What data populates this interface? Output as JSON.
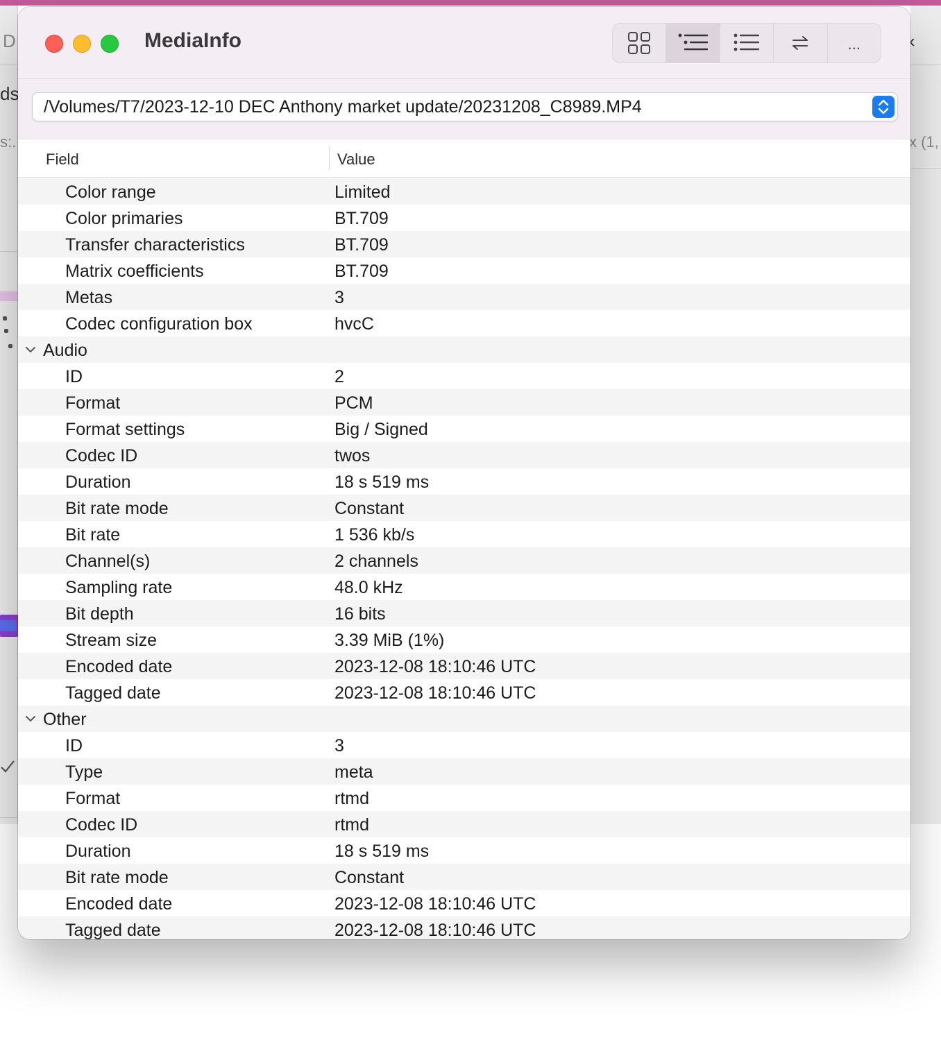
{
  "background": {
    "left_fragments": [
      "D",
      "ds",
      "s:."
    ],
    "right_fragments": [
      "‹",
      "x (1,"
    ]
  },
  "window": {
    "title": "MediaInfo",
    "view_buttons": [
      {
        "icon": "grid-view-icon",
        "active": false
      },
      {
        "icon": "tree-view-icon",
        "active": true
      },
      {
        "icon": "list-view-icon",
        "active": false
      },
      {
        "icon": "compare-arrows-icon",
        "active": false
      },
      {
        "icon": "more-icon",
        "label": "...",
        "active": false
      }
    ],
    "file_path": "/Volumes/T7/2023-12-10 DEC Anthony market update/20231208_C8989.MP4"
  },
  "table": {
    "columns": [
      "Field",
      "Value"
    ],
    "rows": [
      {
        "field": "Color range",
        "value": "Limited"
      },
      {
        "field": "Color primaries",
        "value": "BT.709"
      },
      {
        "field": "Transfer characteristics",
        "value": "BT.709"
      },
      {
        "field": "Matrix coefficients",
        "value": "BT.709"
      },
      {
        "field": "Metas",
        "value": "3"
      },
      {
        "field": "Codec configuration box",
        "value": "hvcC"
      },
      {
        "field": "Audio",
        "value": "",
        "section": true
      },
      {
        "field": "ID",
        "value": "2"
      },
      {
        "field": "Format",
        "value": "PCM"
      },
      {
        "field": "Format settings",
        "value": "Big / Signed"
      },
      {
        "field": "Codec ID",
        "value": "twos"
      },
      {
        "field": "Duration",
        "value": "18 s 519 ms"
      },
      {
        "field": "Bit rate mode",
        "value": "Constant"
      },
      {
        "field": "Bit rate",
        "value": "1 536 kb/s"
      },
      {
        "field": "Channel(s)",
        "value": "2 channels"
      },
      {
        "field": "Sampling rate",
        "value": "48.0 kHz"
      },
      {
        "field": "Bit depth",
        "value": "16 bits"
      },
      {
        "field": "Stream size",
        "value": "3.39 MiB (1%)"
      },
      {
        "field": "Encoded date",
        "value": "2023-12-08 18:10:46 UTC"
      },
      {
        "field": "Tagged date",
        "value": "2023-12-08 18:10:46 UTC"
      },
      {
        "field": "Other",
        "value": "",
        "section": true
      },
      {
        "field": "ID",
        "value": "3"
      },
      {
        "field": "Type",
        "value": "meta"
      },
      {
        "field": "Format",
        "value": "rtmd"
      },
      {
        "field": "Codec ID",
        "value": "rtmd"
      },
      {
        "field": "Duration",
        "value": "18 s 519 ms"
      },
      {
        "field": "Bit rate mode",
        "value": "Constant"
      },
      {
        "field": "Encoded date",
        "value": "2023-12-08 18:10:46 UTC"
      },
      {
        "field": "Tagged date",
        "value": "2023-12-08 18:10:46 UTC"
      }
    ]
  }
}
